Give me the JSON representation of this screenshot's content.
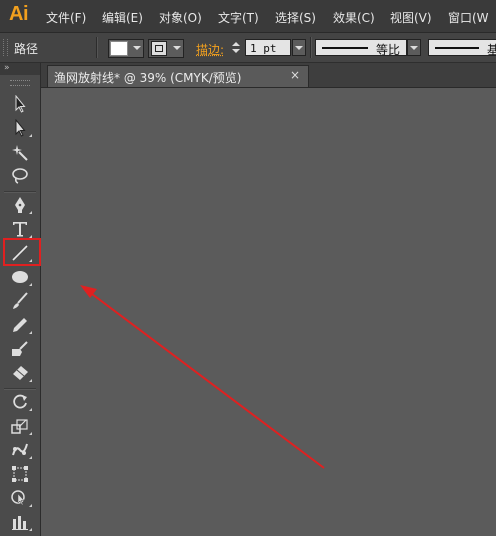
{
  "app": {
    "logo": "Ai",
    "accent_color": "#f2a01e"
  },
  "menu": {
    "items": [
      {
        "label": "文件(F)"
      },
      {
        "label": "编辑(E)"
      },
      {
        "label": "对象(O)"
      },
      {
        "label": "文字(T)"
      },
      {
        "label": "选择(S)"
      },
      {
        "label": "效果(C)"
      },
      {
        "label": "视图(V)"
      },
      {
        "label": "窗口(W"
      }
    ]
  },
  "control_bar": {
    "selection_label": "路径",
    "fill_color": "#ffffff",
    "stroke_label": "描边:",
    "stroke_weight": "1 pt",
    "profile_label": "等比",
    "brush_label_partial": "基"
  },
  "document": {
    "tab_title": "渔网放射线* @ 39% (CMYK/预览)",
    "close_glyph": "×",
    "canvas_color": "#5b5b5b"
  },
  "toolbar": {
    "collapse_glyph": "»",
    "tools": [
      {
        "name": "selection-tool",
        "icon": "arrow-icon"
      },
      {
        "name": "direct-selection-tool",
        "icon": "white-arrow-icon"
      },
      {
        "name": "magic-wand-tool",
        "icon": "magic-wand-icon"
      },
      {
        "name": "lasso-tool",
        "icon": "lasso-icon"
      },
      {
        "name": "pen-tool",
        "icon": "pen-icon"
      },
      {
        "name": "type-tool",
        "icon": "type-icon",
        "glyph": "T"
      },
      {
        "name": "line-segment-tool",
        "icon": "line-icon",
        "selected": true
      },
      {
        "name": "ellipse-tool",
        "icon": "ellipse-icon"
      },
      {
        "name": "paintbrush-tool",
        "icon": "brush-icon"
      },
      {
        "name": "pencil-tool",
        "icon": "pencil-icon"
      },
      {
        "name": "blob-brush-tool",
        "icon": "blob-brush-icon"
      },
      {
        "name": "eraser-tool",
        "icon": "eraser-icon"
      },
      {
        "name": "rotate-tool",
        "icon": "rotate-icon"
      },
      {
        "name": "scale-tool",
        "icon": "scale-icon"
      },
      {
        "name": "puppet-warp-tool",
        "icon": "puppet-warp-icon"
      },
      {
        "name": "free-transform-tool",
        "icon": "free-transform-icon"
      },
      {
        "name": "shape-builder-tool",
        "icon": "shape-builder-icon"
      },
      {
        "name": "graph-tool",
        "icon": "graph-icon"
      }
    ]
  },
  "annotations": {
    "highlight_color": "#e02020",
    "arrow_color": "#e02020"
  }
}
